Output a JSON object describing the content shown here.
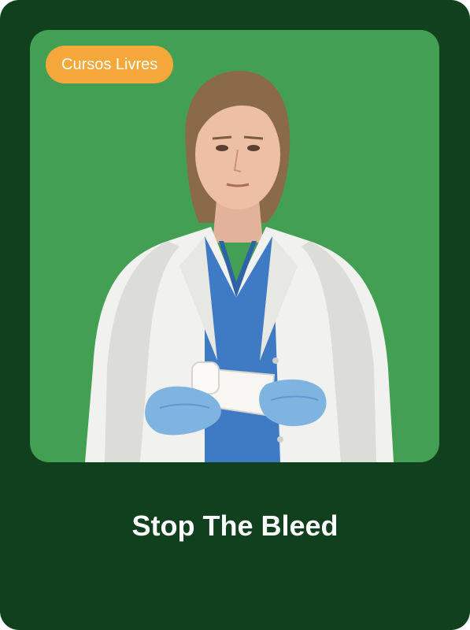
{
  "card": {
    "badge_label": "Cursos Livres",
    "title": "Stop The Bleed",
    "image_alt": "Healthcare worker in white coat and blue scrubs holding a gauze bandage"
  },
  "colors": {
    "card_background": "#10401d",
    "image_background": "#43a052",
    "badge_background": "#f7a83a",
    "title_text": "#ffffff"
  }
}
